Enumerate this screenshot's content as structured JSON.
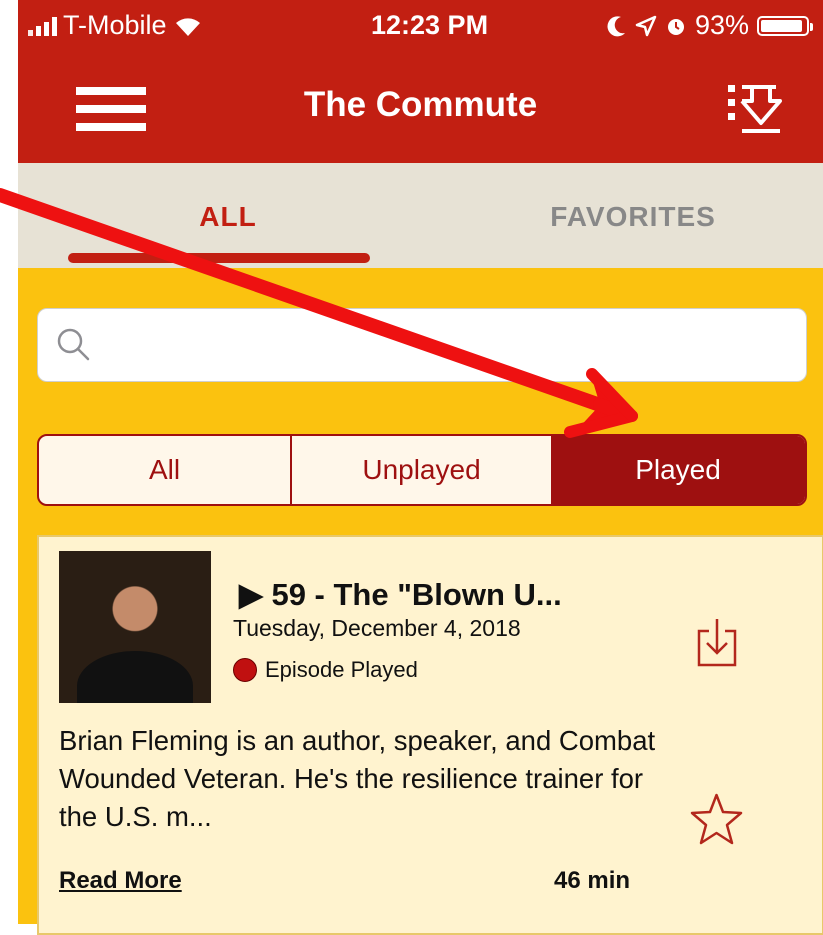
{
  "status_bar": {
    "carrier": "T-Mobile",
    "time": "12:23 PM",
    "battery": "93%",
    "battery_level": 0.93,
    "icons": [
      "signal-icon",
      "wifi-icon",
      "moon-icon",
      "location-icon",
      "alarm-icon",
      "battery-icon"
    ]
  },
  "nav": {
    "title": "The Commute",
    "menu_icon": "hamburger-icon",
    "action_icon": "download-list-icon"
  },
  "tabs": [
    {
      "label": "ALL",
      "selected": true
    },
    {
      "label": "FAVORITES",
      "selected": false
    }
  ],
  "search": {
    "placeholder": "",
    "value": ""
  },
  "filter": {
    "options": [
      "All",
      "Unplayed",
      "Played"
    ],
    "selected": "Played"
  },
  "episode": {
    "title": "▶ 59 - The \"Blown U...",
    "date": "Tuesday, December 4, 2018",
    "status": "Episode Played",
    "description": "Brian Fleming is an author, speaker, and Combat Wounded Veteran. He's the resilience trainer for the U.S. m...",
    "read_more": "Read More",
    "duration": "46 min"
  },
  "colors": {
    "brand_red": "#c21f12",
    "segment_red": "#9e1010",
    "background_yellow": "#fbc20f",
    "tab_bg": "#e7e2d5",
    "card_bg": "#fff3cf",
    "annotation_arrow": "#ee1111"
  }
}
